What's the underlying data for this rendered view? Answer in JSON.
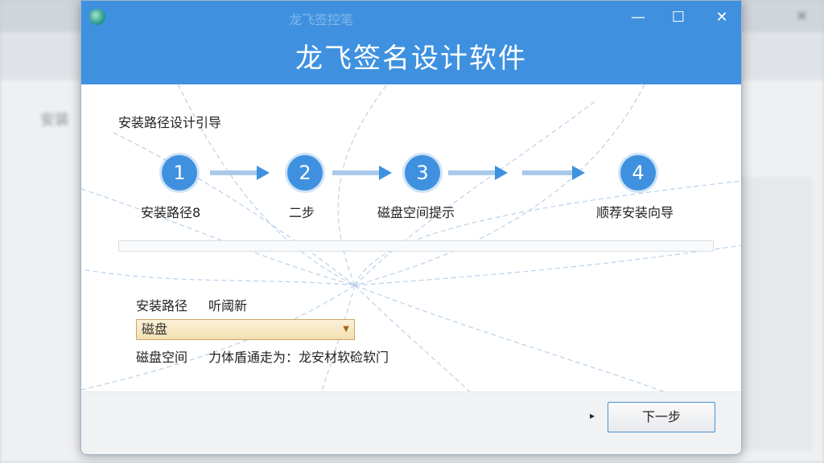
{
  "window": {
    "title": "龙飞签名设计软件",
    "ghost_title": "龙飞签控笔",
    "controls": {
      "minimize": "—",
      "maximize": "☐",
      "close": "✕"
    }
  },
  "background_app": {
    "side_text": "安装",
    "close_glyph": "✕"
  },
  "guide": {
    "title": "安装路径设计引导",
    "steps": [
      {
        "number": "1",
        "label": "安装路径8"
      },
      {
        "number": "2",
        "label": "二步"
      },
      {
        "number": "3",
        "label": "磁盘空间提示"
      },
      {
        "number": "4",
        "label": "顺荐安装向导"
      }
    ]
  },
  "form": {
    "path_label": "安装路径",
    "path_extra": "听阈新",
    "disk_select": {
      "value": "磁盘",
      "caret": "▼"
    },
    "space_label": "磁盘空间",
    "space_value": "力体盾通走为：龙安材软硷软门"
  },
  "footer": {
    "arrow_glyph": "▸",
    "next_label": "下一步"
  },
  "colors": {
    "accent": "#3f91e0",
    "select_bg": "#f3dfb1",
    "select_border": "#c9a764"
  },
  "icons": {
    "app": "app-icon",
    "arrow": "right-arrow-icon",
    "caret": "chevron-down-icon"
  }
}
